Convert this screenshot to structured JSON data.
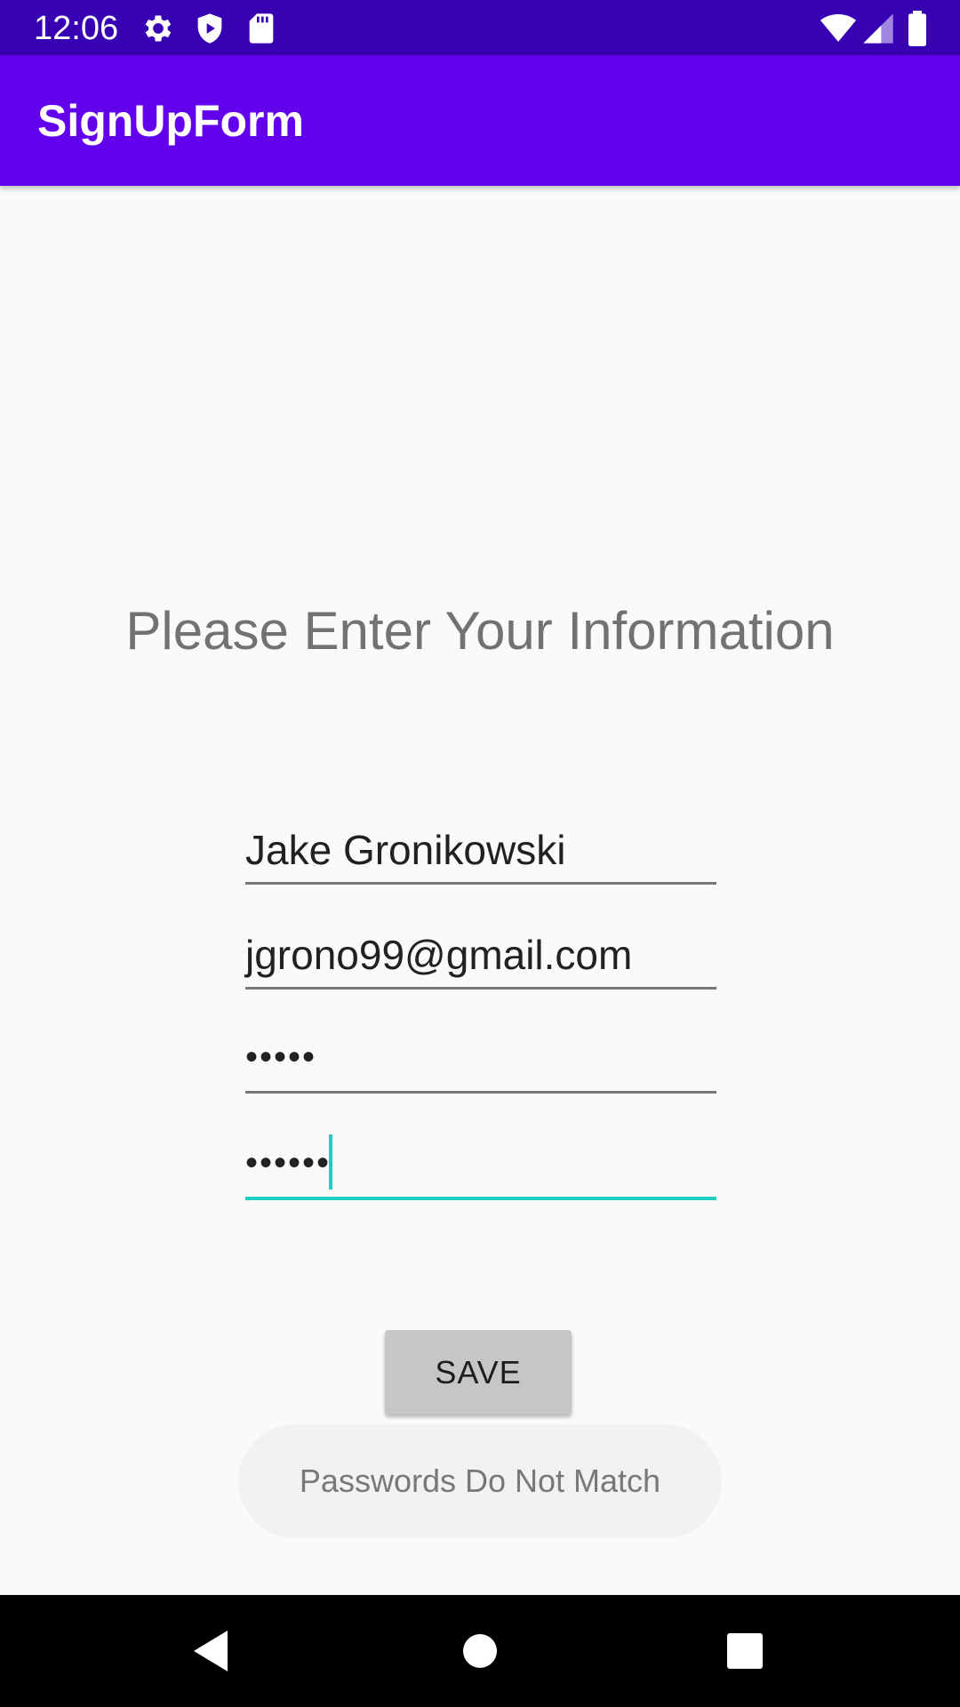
{
  "status_bar": {
    "time": "12:06",
    "left_icons": [
      "gear-icon",
      "shield-icon",
      "sd-card-icon"
    ],
    "right_icons": [
      "wifi-icon",
      "cell-signal-icon",
      "battery-icon"
    ],
    "color": "#3700b3"
  },
  "app_bar": {
    "title": "SignUpForm",
    "color": "#6200ee"
  },
  "form": {
    "heading": "Please Enter Your Information",
    "name_value": "Jake Gronikowski",
    "email_value": "jgrono99@gmail.com",
    "password_value": "•••••",
    "confirm_password_value": "••••••",
    "focus_color": "#1fcfc4"
  },
  "save_button": {
    "label": "SAVE"
  },
  "toast": {
    "message": "Passwords Do Not Match"
  },
  "nav_bar": {
    "buttons": [
      "back-icon",
      "home-icon",
      "recents-icon"
    ]
  }
}
